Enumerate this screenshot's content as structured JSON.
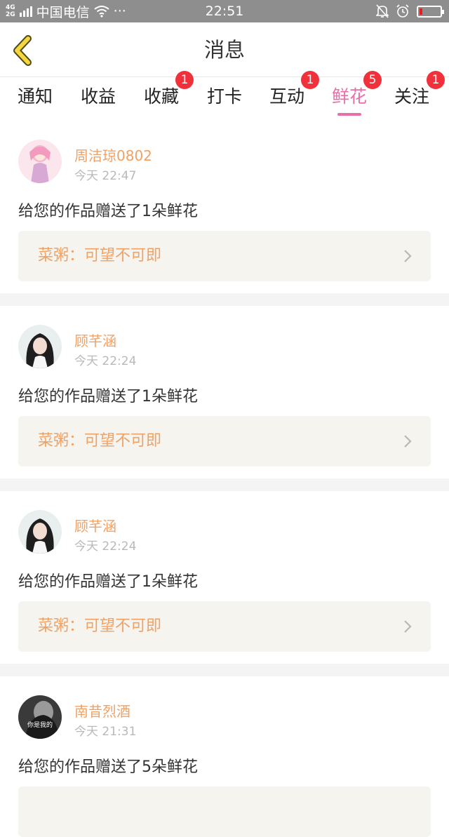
{
  "status_bar": {
    "net_top": "4G",
    "net_bottom": "2G",
    "carrier": "中国电信",
    "more": "···",
    "time": "22:51",
    "battery_level": 0.15,
    "icons": [
      "signal-icon",
      "wifi-icon",
      "bell-off-icon",
      "alarm-icon",
      "battery-icon"
    ]
  },
  "header": {
    "title": "消息",
    "back_icon": "chevron-left-icon"
  },
  "tabs": [
    {
      "label": "通知",
      "badge": ""
    },
    {
      "label": "收益",
      "badge": ""
    },
    {
      "label": "收藏",
      "badge": "1"
    },
    {
      "label": "打卡",
      "badge": ""
    },
    {
      "label": "互动",
      "badge": "1"
    },
    {
      "label": "鲜花",
      "badge": "5",
      "active": true
    },
    {
      "label": "关注",
      "badge": "1"
    }
  ],
  "colors": {
    "accent_pink": "#e96fa8",
    "name_orange": "#f0a266",
    "badge_red": "#f0303a",
    "back_yellow": "#f5d63d"
  },
  "messages": [
    {
      "username": "周洁琼0802",
      "time": "今天 22:47",
      "text": "给您的作品赠送了1朵鲜花",
      "work": "菜粥：可望不可即",
      "avatar": "pink-anime-avatar"
    },
    {
      "username": "顾芊涵",
      "time": "今天 22:24",
      "text": "给您的作品赠送了1朵鲜花",
      "work": "菜粥：可望不可即",
      "avatar": "girl-photo-avatar"
    },
    {
      "username": "顾芊涵",
      "time": "今天 22:24",
      "text": "给您的作品赠送了1朵鲜花",
      "work": "菜粥：可望不可即",
      "avatar": "girl-photo-avatar"
    },
    {
      "username": "南昔烈酒",
      "time": "今天 21:31",
      "text": "给您的作品赠送了5朵鲜花",
      "work": "",
      "avatar": "bw-photo-avatar",
      "avatar_text": "你是我的"
    }
  ]
}
